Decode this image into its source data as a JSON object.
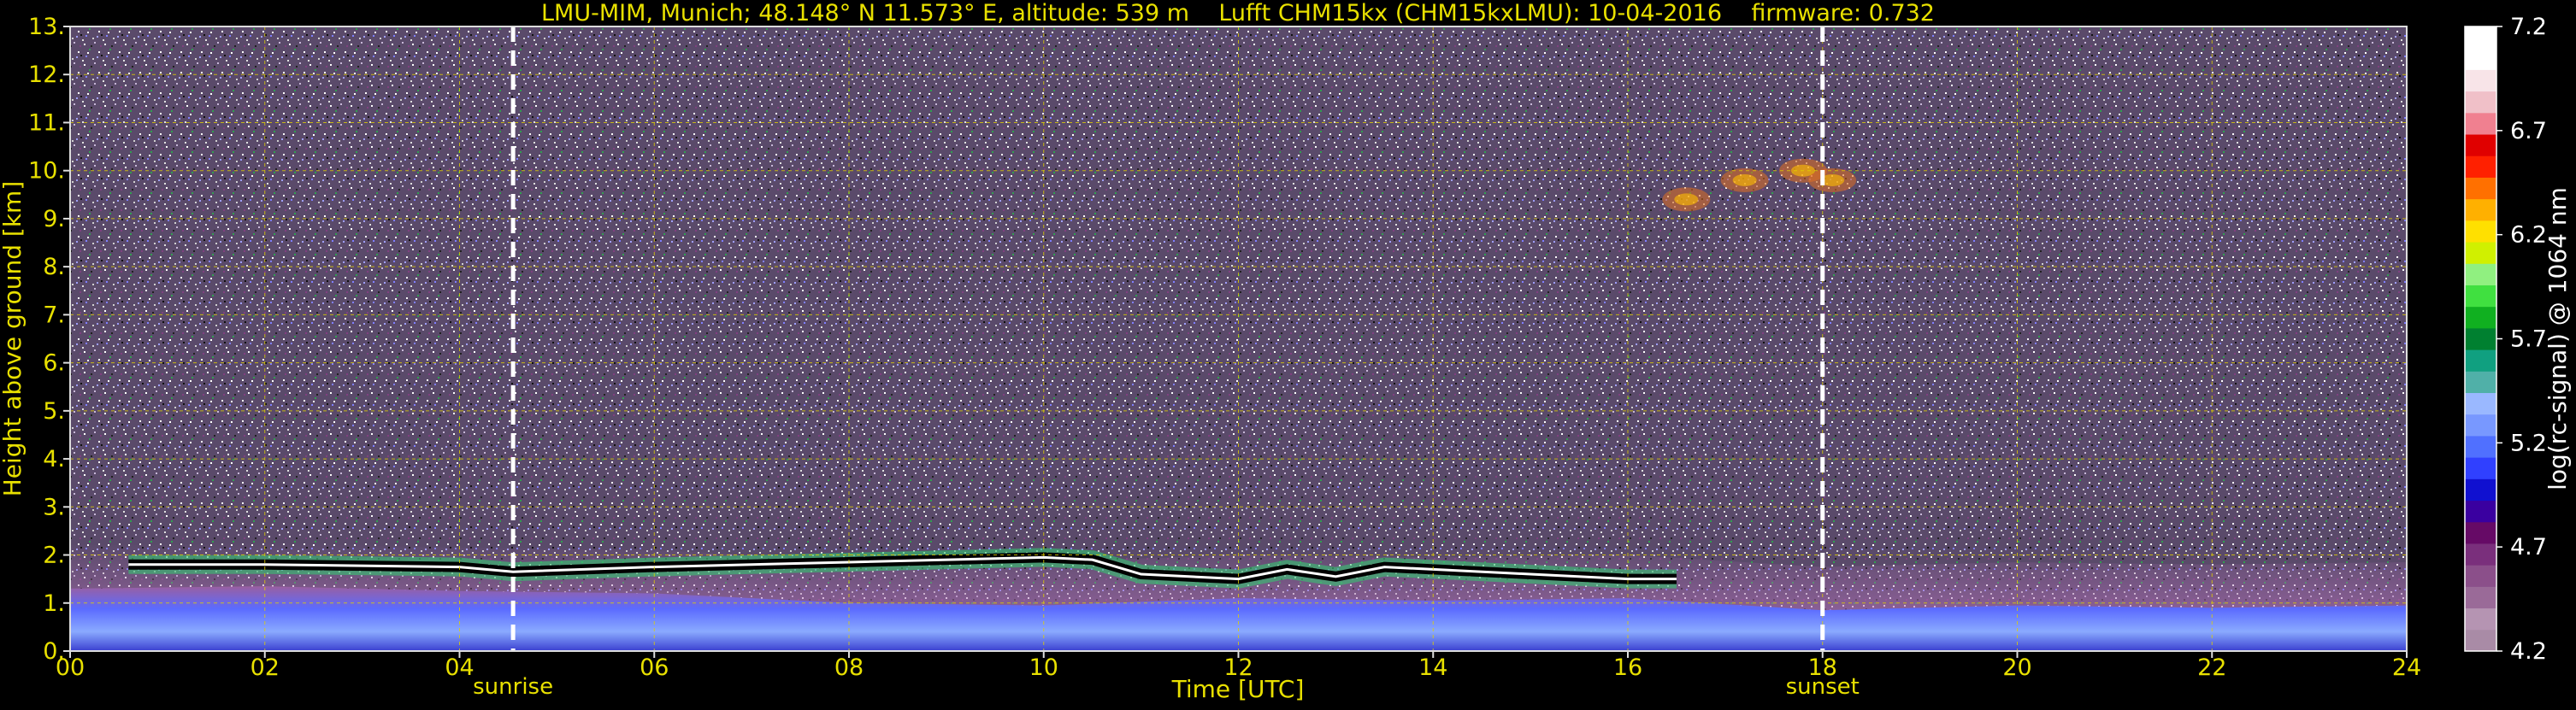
{
  "chart_data": {
    "type": "heatmap",
    "title": "LMU-MIM, Munich; 48.148° N 11.573° E, altitude: 539 m    Lufft CHM15kx (CHM15kxLMU): 10-04-2016    firmware: 0.732",
    "xlabel": "Time [UTC]",
    "ylabel": "Height above ground [km]",
    "xlim": [
      0,
      24
    ],
    "ylim": [
      0,
      13
    ],
    "x_ticks": [
      "00",
      "02",
      "04",
      "06",
      "08",
      "10",
      "12",
      "14",
      "16",
      "18",
      "20",
      "22",
      "24"
    ],
    "y_ticks": [
      "0.",
      "1.",
      "2.",
      "3.",
      "4.",
      "5.",
      "6.",
      "7.",
      "8.",
      "9.",
      "10.",
      "11.",
      "12.",
      "13."
    ],
    "grid": true,
    "annotations": [
      {
        "label": "sunrise",
        "x": 4.55
      },
      {
        "label": "sunset",
        "x": 18.0
      }
    ],
    "colorbar": {
      "label": "log(rc-signal) @ 1064 nm",
      "range": [
        4.2,
        7.2
      ],
      "ticks": [
        "7.2",
        "6.7",
        "6.2",
        "5.7",
        "5.2",
        "4.7",
        "4.2"
      ],
      "colors": [
        "#a98ba6",
        "#b594b2",
        "#9a6a98",
        "#8b4f8a",
        "#7a2f7c",
        "#660a66",
        "#3a00a0",
        "#1010d0",
        "#3040ff",
        "#5070ff",
        "#7898ff",
        "#9ab8ff",
        "#50b0a8",
        "#10a080",
        "#008030",
        "#10b020",
        "#40e040",
        "#90f080",
        "#d0f000",
        "#ffe000",
        "#ffb000",
        "#ff7000",
        "#ff2000",
        "#e00000",
        "#f08090",
        "#f0c0c8",
        "#f8e4e8",
        "#ffffff",
        "#ffffff"
      ]
    },
    "layers": [
      {
        "name": "cloud-base",
        "x": [
          0.6,
          2,
          4,
          4.55,
          6,
          8,
          10,
          10.5,
          11,
          12,
          12.5,
          13,
          13.5,
          14,
          15,
          16,
          16.5
        ],
        "y": [
          1.8,
          1.8,
          1.75,
          1.65,
          1.75,
          1.85,
          1.95,
          1.9,
          1.6,
          1.5,
          1.7,
          1.55,
          1.75,
          1.7,
          1.6,
          1.5,
          1.5
        ]
      },
      {
        "name": "boundary-layer-top",
        "x": [
          0,
          2,
          4,
          6,
          8,
          10,
          12,
          14,
          16,
          18,
          20,
          22,
          24
        ],
        "y": [
          1.3,
          1.35,
          1.25,
          1.2,
          1.0,
          0.95,
          1.1,
          1.05,
          1.1,
          0.85,
          0.95,
          0.9,
          0.95
        ]
      },
      {
        "name": "cirrus",
        "x": [
          16.6,
          17.2,
          17.8,
          18.1
        ],
        "y": [
          9.4,
          9.8,
          10.0,
          9.8
        ]
      }
    ]
  }
}
